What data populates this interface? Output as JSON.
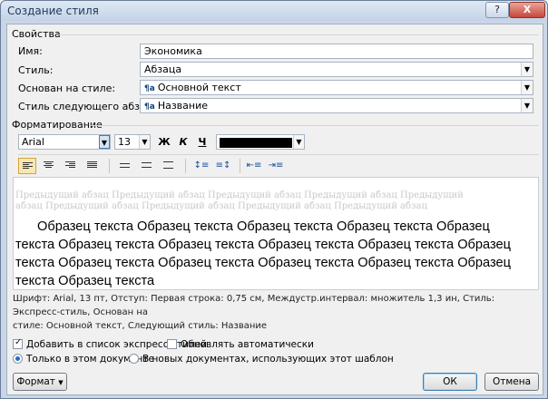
{
  "window": {
    "title": "Создание стиля",
    "help_label": "?",
    "close_label": "X"
  },
  "properties": {
    "group_label": "Свойства",
    "name_label": "Имя:",
    "name_value": "Экономика",
    "style_type_label": "Стиль:",
    "style_type_value": "Абзаца",
    "based_on_label": "Основан на стиле:",
    "based_on_value": "Основной текст",
    "next_style_label": "Стиль следующего абзаца:",
    "next_style_value": "Название",
    "style_icon": "¶a"
  },
  "formatting": {
    "group_label": "Форматирование",
    "font_name": "Arial",
    "font_size": "13",
    "bold_label": "Ж",
    "italic_label": "К",
    "underline_label": "Ч",
    "font_color": "#000000"
  },
  "preview": {
    "previous_paragraph": "Предыдущий абзац Предыдущий абзац Предыдущий абзац Предыдущий абзац Предыдущий абзац Предыдущий абзац Предыдущий абзац Предыдущий абзац Предыдущий абзац",
    "sample_lines": [
      "Образец текста Образец текста Образец текста Образец текста Образец",
      "текста Образец текста Образец текста Образец текста Образец текста Образец",
      "текста Образец текста Образец текста Образец текста Образец текста Образец",
      "текста Образец текста"
    ]
  },
  "description": {
    "line1": "Шрифт: Arial, 13 пт, Отступ: Первая строка:  0,75 см, Междустр.интервал:  множитель 1,3 ин, Стиль: Экспресс-стиль, Основан на",
    "line2": "стиле: Основной текст, Следующий стиль: Название"
  },
  "options": {
    "add_quick_styles": "Добавить в список экспресс-стилей",
    "add_quick_styles_checked": true,
    "auto_update": "Обновлять автоматически",
    "auto_update_checked": false,
    "only_this_document": "Только в этом документе",
    "new_documents": "В новых документах, использующих этот шаблон",
    "selected_scope": "only_this_document"
  },
  "buttons": {
    "format_label": "Формат",
    "ok_label": "ОК",
    "cancel_label": "Отмена"
  }
}
